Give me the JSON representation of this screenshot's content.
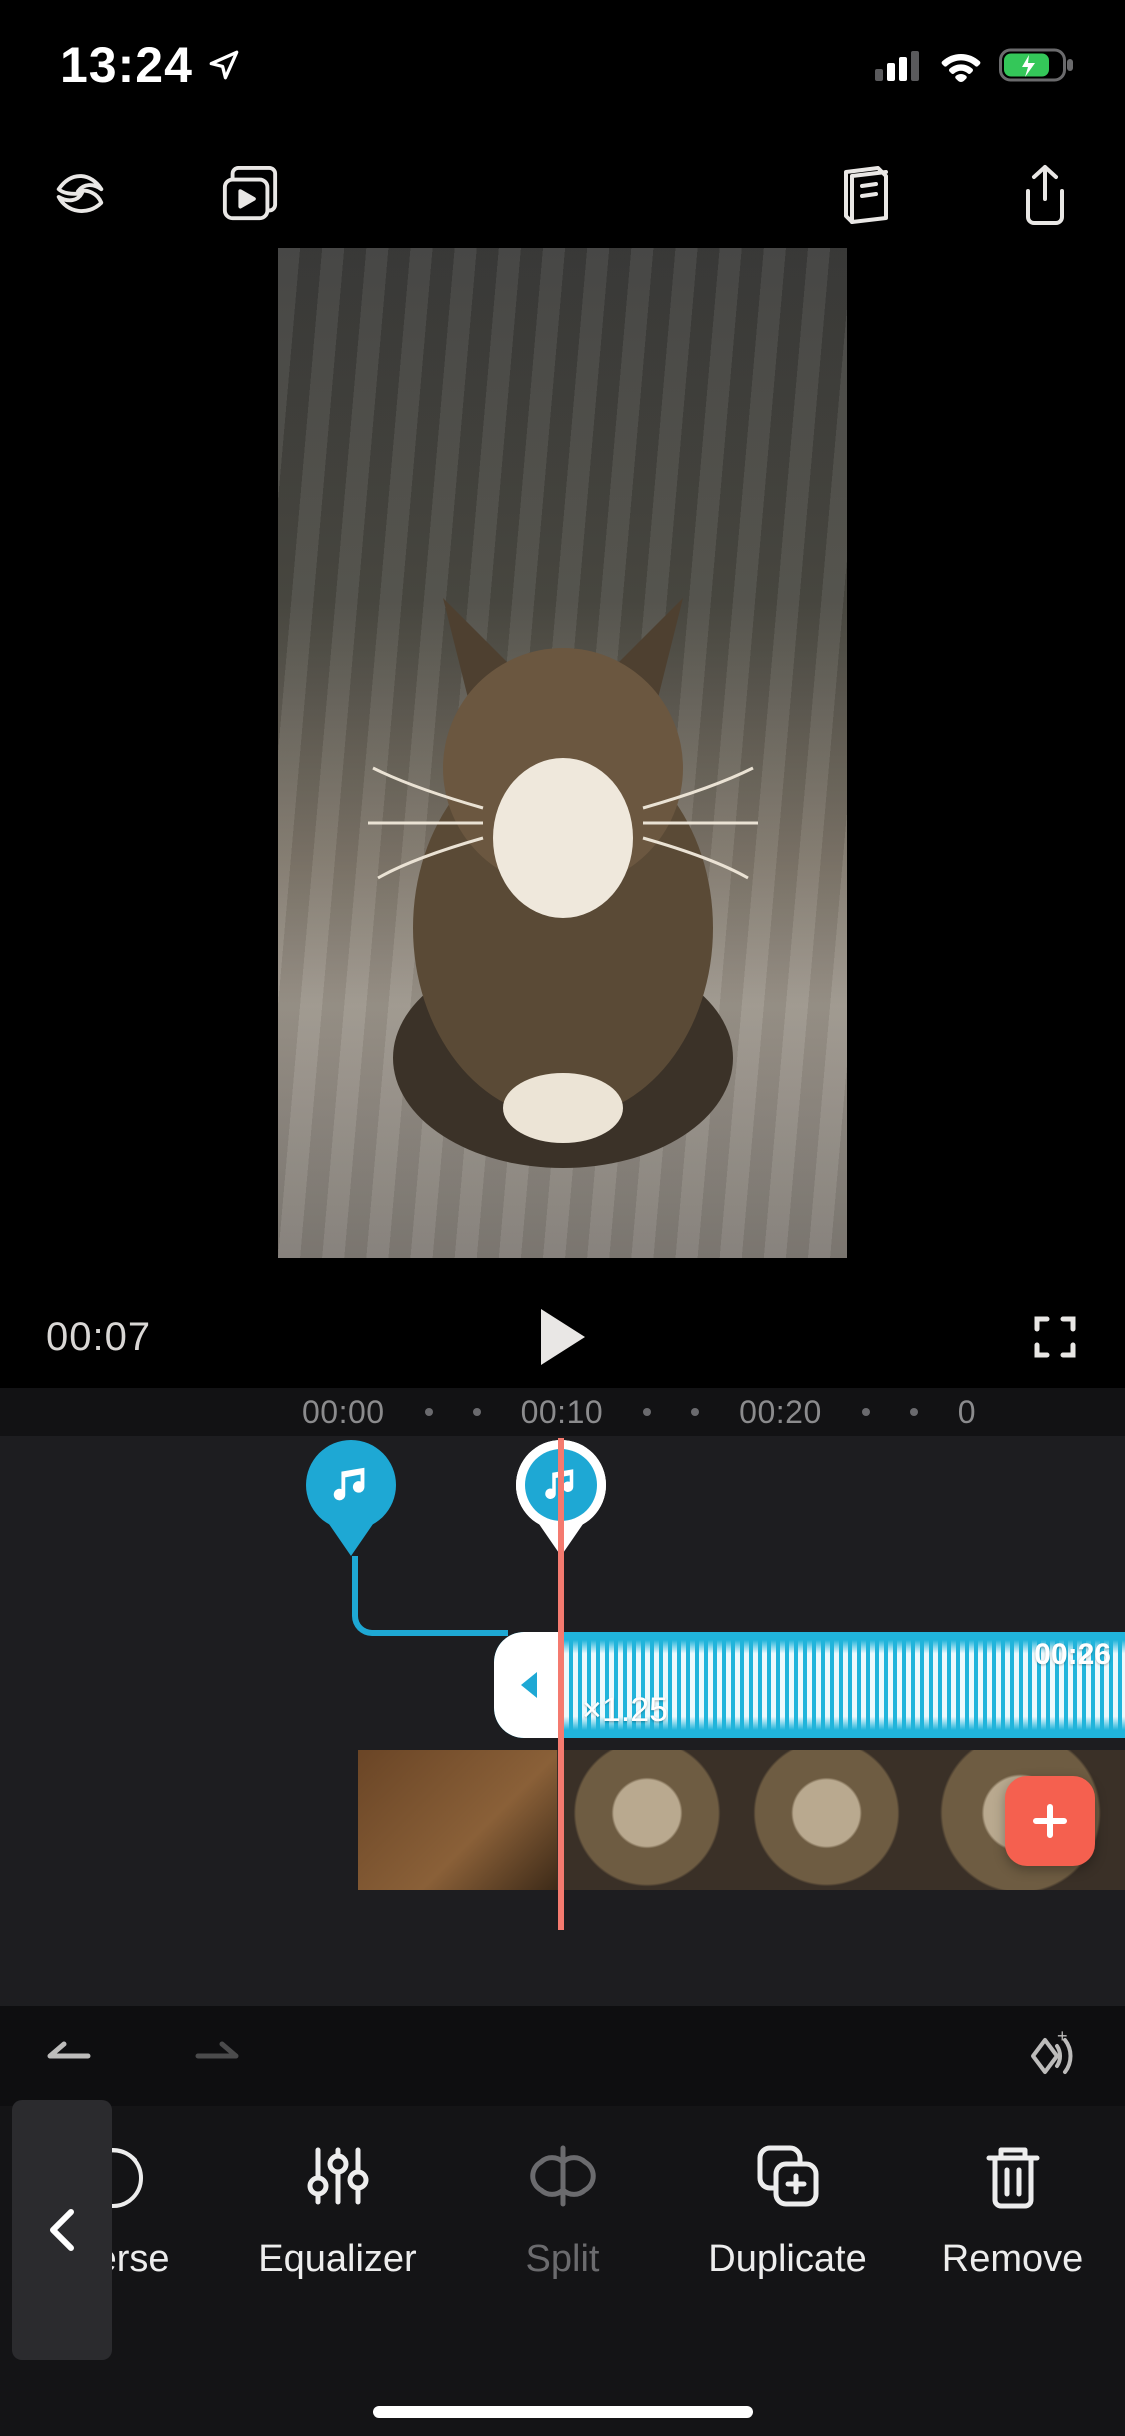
{
  "status": {
    "time": "13:24"
  },
  "transport": {
    "current_time": "00:07"
  },
  "ruler": {
    "ticks": [
      "00:00",
      "00:10",
      "00:20",
      "0"
    ]
  },
  "audio_clip": {
    "duration_label": "00:26",
    "speed_label": "×1.25"
  },
  "tools": {
    "reverse": "everse",
    "equalizer": "Equalizer",
    "split": "Split",
    "duplicate": "Duplicate",
    "remove": "Remove"
  },
  "colors": {
    "accent": "#1ea8d4",
    "add": "#f5604f",
    "playhead": "#f47a6f"
  }
}
